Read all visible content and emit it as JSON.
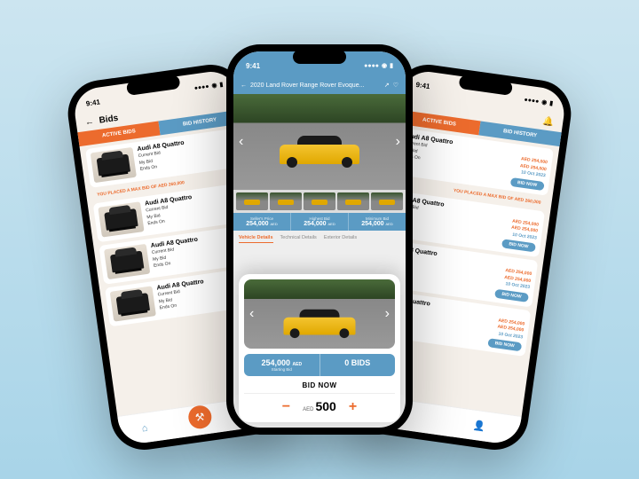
{
  "colors": {
    "accent": "#ec6b2d",
    "secondary": "#5b9bc4"
  },
  "time": "9:41",
  "side": {
    "title": "Bids",
    "tabs": {
      "active": "ACTIVE BIDS",
      "history": "BID HISTORY"
    },
    "max_banner": "YOU PLACED A MAX BID OF AED 260,000",
    "item": {
      "title": "Audi A8 Quattro",
      "current_label": "Current Bid",
      "current_val": "AED 254,000",
      "mybid_label": "My Bid",
      "mybid_val": "AED 254,000",
      "ends_label": "Ends On",
      "ends_val": "10 Oct 2023",
      "btn": "BID NOW"
    }
  },
  "center": {
    "title": "2020 Land Rover Range Rover Evoque...",
    "prices": {
      "seller": {
        "label": "Seller's Price",
        "val": "254,000",
        "cur": "AED"
      },
      "highest": {
        "label": "Highest Bid",
        "val": "254,000",
        "cur": "AED"
      },
      "minimum": {
        "label": "Minimum Bid",
        "val": "254,000",
        "cur": "AED"
      }
    },
    "detail_tabs": {
      "vehicle": "Vehicle Details",
      "technical": "Technical Details",
      "exterior": "Exterior Details"
    },
    "modal": {
      "starting": {
        "val": "254,000",
        "cur": "AED",
        "label": "Starting Bid"
      },
      "bids": {
        "val": "0 BIDS"
      },
      "title": "BID NOW",
      "currency": "AED",
      "amount": "500"
    }
  }
}
